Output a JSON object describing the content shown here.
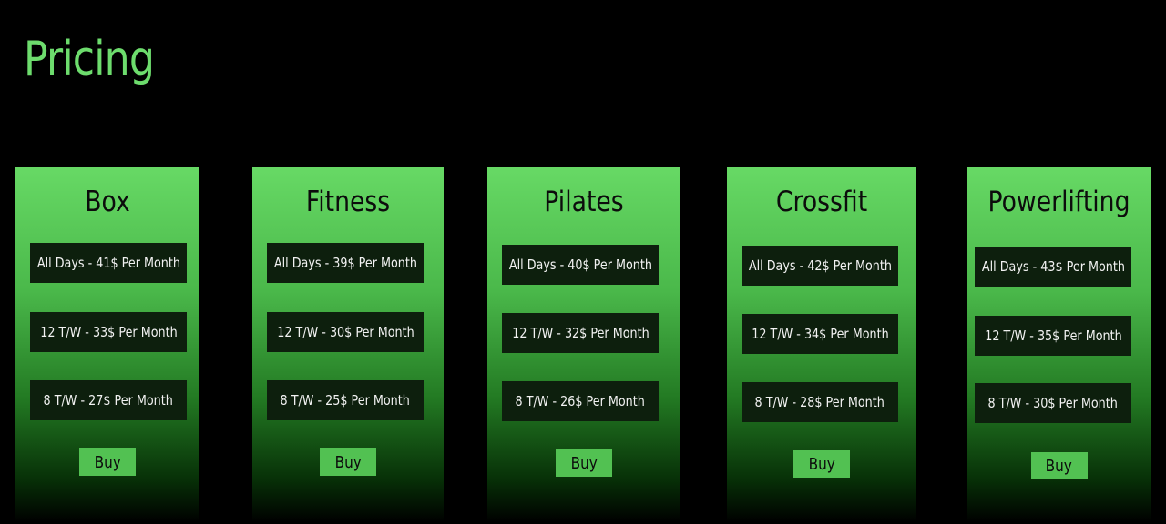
{
  "page": {
    "title": "Pricing"
  },
  "plans": [
    {
      "name": "Box",
      "prices": [
        "All Days - 41$ Per Month",
        "12 T/W - 33$ Per Month",
        "8 T/W - 27$ Per Month"
      ],
      "buy_label": "Buy"
    },
    {
      "name": "Fitness",
      "prices": [
        "All Days - 39$ Per Month",
        "12 T/W - 30$ Per Month",
        "8 T/W - 25$ Per Month"
      ],
      "buy_label": "Buy"
    },
    {
      "name": "Pilates",
      "prices": [
        "All Days - 40$ Per Month",
        "12 T/W - 32$ Per Month",
        "8 T/W - 26$ Per Month"
      ],
      "buy_label": "Buy"
    },
    {
      "name": "Crossfit",
      "prices": [
        "All Days - 42$ Per Month",
        "12 T/W - 34$ Per Month",
        "8 T/W - 28$ Per Month"
      ],
      "buy_label": "Buy"
    },
    {
      "name": "Powerlifting",
      "prices": [
        "All Days - 43$ Per Month",
        "12 T/W - 35$ Per Month",
        "8 T/W - 30$ Per Month"
      ],
      "buy_label": "Buy"
    }
  ],
  "colors": {
    "background": "#000000",
    "accent": "#6ddc6d",
    "card_top": "#67d965",
    "price_box": "#0d1f0d",
    "buy_button": "#52c152"
  }
}
